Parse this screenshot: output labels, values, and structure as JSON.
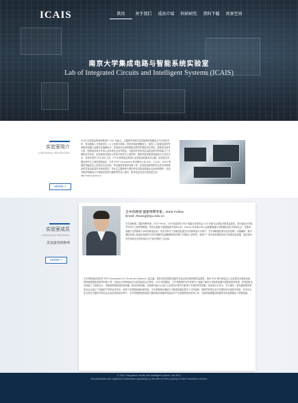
{
  "header": {
    "logo": "ICAIS",
    "nav": [
      "首页",
      "关于我们",
      "成员介绍",
      "科研研究",
      "资料下载",
      "共享空间"
    ],
    "active_index": 0
  },
  "hero": {
    "title": "南京大学集成电路与智能系统实验室",
    "subtitle": "Lab of Integrated Circuits and Intelligent Systems (ICAIS)"
  },
  "intro": {
    "section_cn": "实验室简介",
    "section_en": "Laboratory Introduction",
    "more": "MORE >",
    "text": "ICAIS 实验室由陈睿轩教授于 2011 年建立。主要研究领域为高性能集成电路设计与可靠性分析，低功耗嵌入式系统设计，片上系统与网络，异构多核处理器设计，面向人工智能应用的专用集成电路以及硬件加速器设计。实验室先后承担国家自然科学基金重点项目、国家重点研发计划、国家科技重大专项以及多项企业合作项目，与国内外多所知名高校及研究机构建立了长期的合作关系。实验室依托南京大学电子科学与工程学院，拥有完善的集成电路设计与测试平台，包括先进的 EDA 设计工具、FPGA 原型验证系统以及多种高精度测试仪器。实验室注重理论研究与工程实践相结合，已在 IEEE Transactions 系列期刊以及 DAC、ICCAD、DATE 等国际顶级会议上发表论文百余篇，申请国家发明专利数十项。实验室培养的研究生多次获得国家奖学金及各类学术竞赛奖项，毕业生主要就职于国内外知名集成电路企业及科研院所。欢迎对集成电路设计与智能系统感兴趣的同学加入我们。更多信息请访问实验室主页：http://icais.nju.edu.cn"
  },
  "director": {
    "section_cn": "实验室成员",
    "section_en": "Laboratory Members",
    "sub_link": "实验室领衔教师",
    "more": "MORE >",
    "name": "王中风教授 国家特聘专家，IEEE Fellow",
    "email": "Email: zfwang@nju.edu.cn",
    "bio1": "王中风教授，国家特聘专家，IEEE Fellow。2007年起担任 IEEE 电路与系统协会 VLSI 系统与应用技术委员会委员，现为南京大学电子科学与工程学院教授。他先后就职于美国国家半导体公司、Marvell 半导体公司以及美国博通公司等国际知名半导体企业，在集成电路产业界拥有十余年的研发经历，负责并参与了多款高性能芯片的架构设计与量产。王中风教授在数字信号处理、纠错编码、数字通信系统以及面向深度学习的专用硬件加速器等领域开展了长期深入的研究，取得了一系列具有国际影响力的原创性成果，相关技术已在多家企业的商用芯片产品中得到广泛应用。",
    "bio2": "王中风教授目前担任 IEEE Transactions on Circuits and Systems I 副主编，曾多次担任国际顶级学术会议技术程序委员会委员。他在 IEEE 期刊和会议上共发表论文两百余篇，获得美国授权发明专利数十项，多篇论文获得最佳论文奖或最佳论文提名。2013 年回国后，王中风教授作为学术带头人组建了南京大学集成电路与智能系统实验室，带领团队在高效能人工智能芯片、低密度奇偶校验码译码器、极化码译码器、高速串行接口以及片上系统设计等方向取得了丰硕的研究成果。实验室已与华为、中兴通讯、紫光展锐等多家知名企业建立了深度的产学研合作关系，承担了多项国家级科研项目。王中风教授长期致力于集成电路高层次人才的培养，指导的研究生多次在国际学术竞赛中获奖，多名毕业生已成长为国内外知名企业及高校的技术骨干。王中风教授还积极参与国内集成电路学科建设与产业发展规划的咨询工作，为推动我国集成电路事业的发展做出了重要贡献。"
  },
  "footer": {
    "line1": "© 2021 Integrated circuits and intelligent system. Lab NJU",
    "line2": "All trademarks and registered trademarks appearing on this site are the property of their respective owners."
  }
}
